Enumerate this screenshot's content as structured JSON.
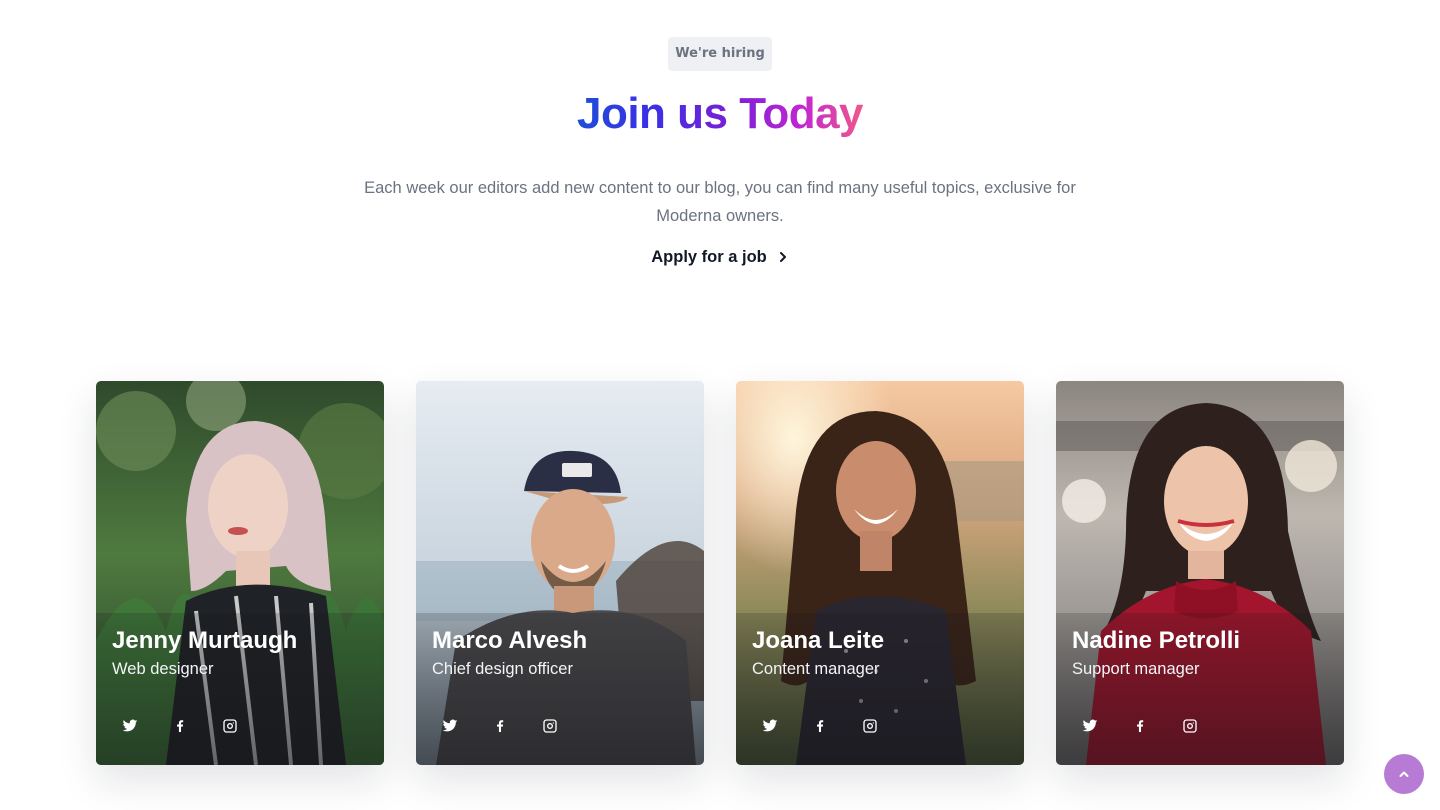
{
  "hero": {
    "badge": "We're hiring",
    "title": "Join us Today",
    "subtitle": "Each week our editors add new content to our blog, you can find many useful topics, exclusive for Moderna owners.",
    "apply_label": "Apply for a job"
  },
  "colors": {
    "title_gradient": [
      "#1d4ed8",
      "#7c1fd6",
      "#c026d3",
      "#f0588a"
    ],
    "back_to_top": "#b77bd6",
    "badge_bg": "#eef0f4"
  },
  "team": [
    {
      "name": "Jenny Murtaugh",
      "role": "Web designer",
      "photo": "woman-with-pink-hair-in-tall-grass",
      "socials": [
        "twitter-icon",
        "facebook-icon",
        "instagram-icon"
      ]
    },
    {
      "name": "Marco Alvesh",
      "role": "Chief design officer",
      "photo": "man-in-cap-by-the-water",
      "socials": [
        "twitter-icon",
        "facebook-icon",
        "instagram-icon"
      ]
    },
    {
      "name": "Joana Leite",
      "role": "Content manager",
      "photo": "smiling-woman-at-sunset",
      "socials": [
        "twitter-icon",
        "facebook-icon",
        "instagram-icon"
      ]
    },
    {
      "name": "Nadine Petrolli",
      "role": "Support manager",
      "photo": "smiling-woman-in-red-sweater",
      "socials": [
        "twitter-icon",
        "facebook-icon",
        "instagram-icon"
      ]
    }
  ],
  "back_to_top_icon": "chevron-up-icon"
}
